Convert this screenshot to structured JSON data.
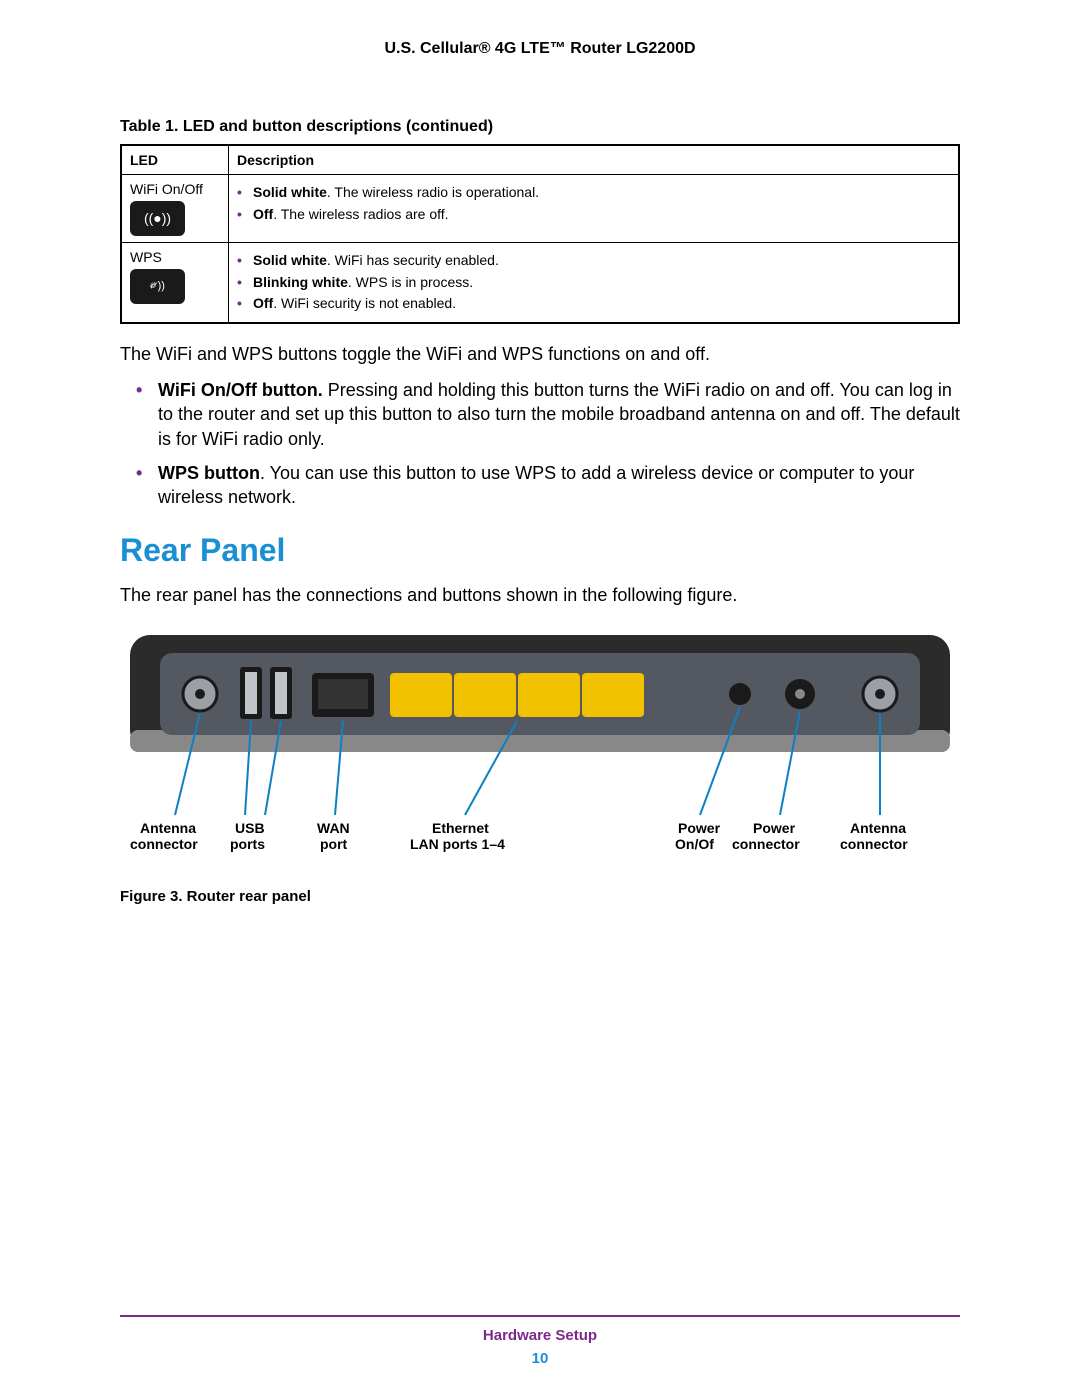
{
  "header": {
    "title": "U.S. Cellular® 4G LTE™ Router LG2200D"
  },
  "table": {
    "caption": "Table 1.  LED and button descriptions  (continued)",
    "headers": [
      "LED",
      "Description"
    ],
    "rows": [
      {
        "led": "WiFi On/Off",
        "icon": "wifi-onoff-icon",
        "items": [
          {
            "bold": "Solid white",
            "rest": ". The wireless radio is operational."
          },
          {
            "bold": "Off",
            "rest": ". The wireless radios are off."
          }
        ]
      },
      {
        "led": "WPS",
        "icon": "wps-icon",
        "items": [
          {
            "bold": "Solid white",
            "rest": ". WiFi has security enabled."
          },
          {
            "bold": "Blinking white",
            "rest": ". WPS is in process."
          },
          {
            "bold": "Off",
            "rest": ". WiFi security is not enabled."
          }
        ]
      }
    ]
  },
  "intro_text": "The WiFi and WPS buttons toggle the WiFi and WPS functions on and off.",
  "button_bullets": [
    {
      "bold": "WiFi On/Off button.",
      "rest": " Pressing and holding this button turns the WiFi radio on and off. You can log in to the router and set up this button to also turn the mobile broadband antenna on and off. The default is for WiFi radio only."
    },
    {
      "bold": "WPS button",
      "rest": ". You can use this button to use WPS to add a wireless device or computer to your wireless network."
    }
  ],
  "section_heading": "Rear Panel",
  "rear_intro": "The rear panel has the connections and buttons shown in the following figure.",
  "callouts": {
    "antenna_left": {
      "l1": "Antenna",
      "l2": "connector"
    },
    "usb": {
      "l1": "USB",
      "l2": "ports"
    },
    "wan": {
      "l1": "WAN",
      "l2": "port"
    },
    "ethernet": {
      "l1": "Ethernet",
      "l2": "LAN ports 1–4"
    },
    "power_btn": {
      "l1": "Power",
      "l2": "On/Of"
    },
    "power_conn": {
      "l1": "Power",
      "l2": "connector"
    },
    "antenna_right": {
      "l1": "Antenna",
      "l2": "connector"
    }
  },
  "figure_caption": "Figure 3. Router rear panel",
  "footer": {
    "section": "Hardware Setup",
    "page": "10"
  }
}
